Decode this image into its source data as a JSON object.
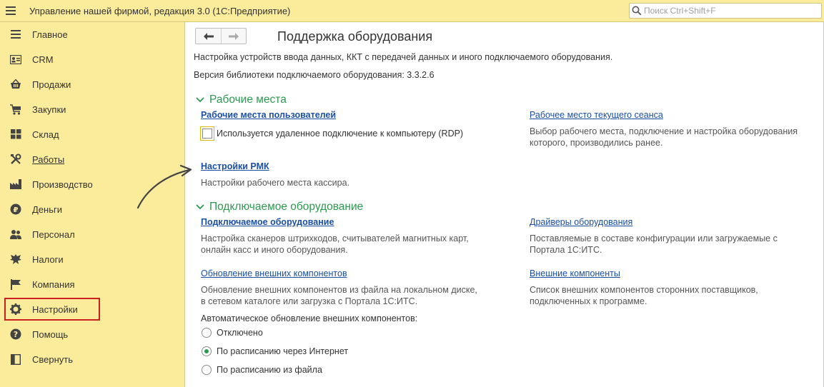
{
  "app": {
    "title": "Управление нашей фирмой, редакция 3.0  (1С:Предприятие)",
    "search_placeholder": "Поиск Ctrl+Shift+F"
  },
  "sidebar": {
    "items": [
      {
        "label": "Главное",
        "icon": "menu-lines-icon"
      },
      {
        "label": "CRM",
        "icon": "contact-card-icon"
      },
      {
        "label": "Продажи",
        "icon": "shop-basket-icon"
      },
      {
        "label": "Закупки",
        "icon": "cart-icon"
      },
      {
        "label": "Склад",
        "icon": "warehouse-grid-icon"
      },
      {
        "label": "Работы",
        "icon": "tools-icon"
      },
      {
        "label": "Производство",
        "icon": "factory-icon"
      },
      {
        "label": "Деньги",
        "icon": "ruble-coin-icon"
      },
      {
        "label": "Персонал",
        "icon": "people-icon"
      },
      {
        "label": "Налоги",
        "icon": "eagle-emblem-icon"
      },
      {
        "label": "Компания",
        "icon": "flag-icon"
      },
      {
        "label": "Настройки",
        "icon": "gear-icon"
      },
      {
        "label": "Помощь",
        "icon": "question-icon"
      },
      {
        "label": "Свернуть",
        "icon": "collapse-panel-icon"
      }
    ]
  },
  "main": {
    "title": "Поддержка оборудования",
    "description": "Настройка устройств ввода данных, ККТ с передачей данных и иного подключаемого оборудования.",
    "version_text": "Версия библиотеки подключаемого оборудования: 3.3.2.6",
    "section_workplaces": {
      "title": "Рабочие места",
      "user_workplaces_link": "Рабочие места пользователей",
      "rdp_checkbox_label": "Используется удаленное подключение к компьютеру (RDP)",
      "rdp_checked": false,
      "current_session_link": "Рабочее место текущего сеанса",
      "current_session_note": [
        "Выбор рабочего места, подключение и настройка оборудования",
        "которого, производились ранее."
      ],
      "rmk_link": "Настройки РМК",
      "rmk_note": "Настройки рабочего места кассира."
    },
    "section_equipment": {
      "title": "Подключаемое оборудование",
      "equipment_link": "Подключаемое оборудование",
      "equipment_note": [
        "Настройка сканеров штрихкодов, считывателей магнитных карт,",
        "онлайн касс и иного оборудования."
      ],
      "drivers_link": "Драйверы оборудования",
      "drivers_note": [
        "Поставляемые в составе конфигурации или загружаемые с",
        "Портала 1С:ИТС."
      ],
      "update_components_link": "Обновление внешних компонентов",
      "update_components_note": [
        "Обновление внешних компонентов из файла на локальном диске,",
        "в сетевом каталоге или загрузка с Портала 1С:ИТС."
      ],
      "external_components_link": "Внешние компоненты",
      "external_components_note": [
        "Список внешних компонентов сторонних поставщиков,",
        "подключенных к программе."
      ],
      "auto_update_label": "Автоматическое обновление внешних компонентов:",
      "radio_options": [
        "Отключено",
        "По расписанию через Интернет",
        "По расписанию из файла"
      ],
      "radio_selected": "По расписанию через Интернет"
    }
  },
  "colors": {
    "sidebar_bg": "#fbec9b",
    "section_green": "#2b9a4f",
    "link_blue": "#1a4fa3",
    "highlight_red": "#cc1f1f"
  }
}
